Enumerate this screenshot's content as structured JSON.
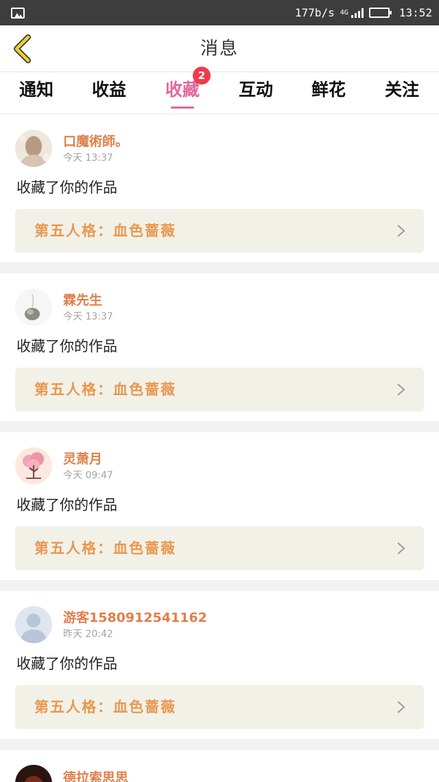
{
  "status_bar": {
    "speed": "177b/s",
    "network": "4G",
    "time": "13:52",
    "icons": [
      "gallery-icon",
      "signal-icon",
      "battery-icon"
    ]
  },
  "header": {
    "title": "消息",
    "back_icon": "chevron-left-icon"
  },
  "tabs": [
    {
      "label": "通知"
    },
    {
      "label": "收益"
    },
    {
      "label": "收藏",
      "badge": "2",
      "active": true
    },
    {
      "label": "互动"
    },
    {
      "label": "鲜花"
    },
    {
      "label": "关注"
    }
  ],
  "messages": [
    {
      "user": "口魔術師。",
      "time": "今天 13:37",
      "action": "收藏了你的作品",
      "work": "第五人格：血色蔷薇"
    },
    {
      "user": "霖先生",
      "time": "今天 13:37",
      "action": "收藏了你的作品",
      "work": "第五人格：血色蔷薇"
    },
    {
      "user": "灵萧月",
      "time": "今天 09:47",
      "action": "收藏了你的作品",
      "work": "第五人格：血色蔷薇"
    },
    {
      "user": "游客1580912541162",
      "time": "昨天 20:42",
      "action": "收藏了你的作品",
      "work": "第五人格：血色蔷薇"
    },
    {
      "user": "德拉索思思"
    }
  ],
  "colors": {
    "accent": "#e0699d",
    "username": "#e07f4b",
    "work_title": "#e9974e",
    "badge": "#ef3b4d",
    "back_arrow": "#e6d04a"
  }
}
